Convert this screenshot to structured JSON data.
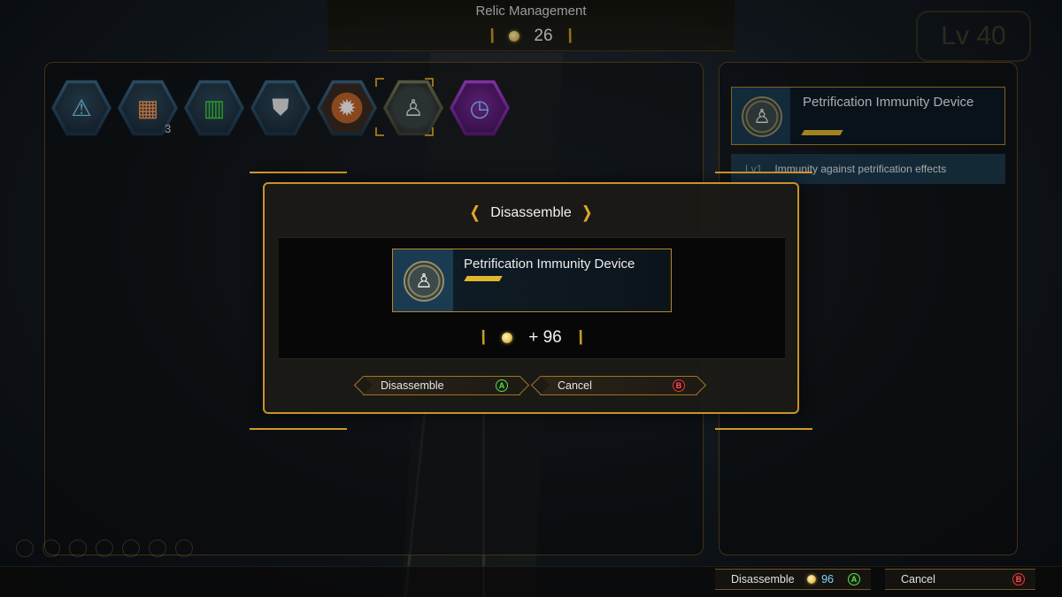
{
  "header": {
    "title": "Relic Management",
    "currency_value": "26",
    "level_badge": "Lv 40"
  },
  "relics": {
    "items": [
      {
        "icon": "alert-shield-icon",
        "glyph": "!"
      },
      {
        "icon": "armor-plate-icon",
        "glyph": "▮",
        "count": "3"
      },
      {
        "icon": "green-armor-icon",
        "glyph": "▮"
      },
      {
        "icon": "boots-icon",
        "glyph": "⛊"
      },
      {
        "icon": "fire-target-icon",
        "glyph": "✹"
      },
      {
        "icon": "petrification-figure-icon",
        "glyph": "♙"
      },
      {
        "icon": "clock-icon",
        "glyph": "◷"
      }
    ]
  },
  "detail": {
    "name": "Petrification Immunity Device",
    "effect_level": "Lv1",
    "effect_text": "Immunity against petrification effects"
  },
  "dialog": {
    "title": "Disassemble",
    "item_name": "Petrification Immunity Device",
    "gain": "+ 96",
    "confirm_label": "Disassemble",
    "confirm_key": "A",
    "cancel_label": "Cancel",
    "cancel_key": "B"
  },
  "bottom_bar": {
    "disassemble_label": "Disassemble",
    "disassemble_cost": "96",
    "disassemble_key": "A",
    "cancel_label": "Cancel",
    "cancel_key": "B"
  },
  "colors": {
    "accent_gold": "#c8922a",
    "rarity_bar": "#e0b62c",
    "confirm_key": "#6cd25a",
    "cancel_key": "#e23a3a"
  }
}
